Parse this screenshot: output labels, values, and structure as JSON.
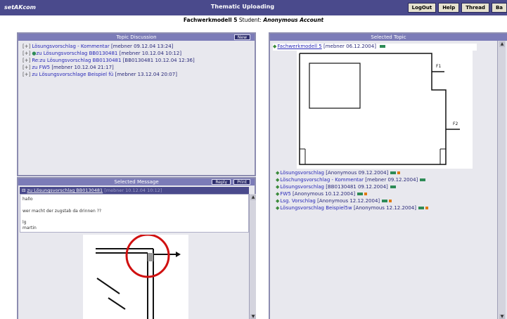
{
  "app": {
    "logo": "setAKcom",
    "title": "Thematic Uploading",
    "buttons": [
      "LogOut",
      "Help",
      "Thread",
      "Ba"
    ]
  },
  "subtitle": {
    "topic": "Fachwerkmodell 5",
    "student_label": "Student:",
    "student": "Anonymous Account"
  },
  "topic_discussion": {
    "title": "Topic Discussion",
    "new_label": "New",
    "rows": [
      {
        "tree": "[+]",
        "title": "Lösungsvorschlag - Kommentar",
        "meta": "[mebner 09.12.04 13:24]"
      },
      {
        "tree": "[+]",
        "title": "zu Lösungsvorschlag BB0130481",
        "meta": "[mebner 10.12.04 10:12]"
      },
      {
        "tree": "[+]",
        "title": "Re:zu Lösungsvorschlag BB0130481",
        "meta": "[BB0130481 10.12.04 12:36]"
      },
      {
        "tree": "[+]",
        "title": "zu FW5",
        "meta": "[mebner 10.12.04 21:17]"
      },
      {
        "tree": "[+]",
        "title": "zu Lösungsvorschlage Beispiel fü",
        "meta": "[mebner 13.12.04 20:07]"
      }
    ]
  },
  "selected_message": {
    "title": "Selected Message",
    "reply_label": "Reply",
    "print_label": "Print",
    "subject": "zu Lösungsvorschlag BB0130481",
    "subject_meta": "[mebner 10.12.04 10:12]",
    "body_lines": [
      "hallo",
      "wer macht der zugstab da drinnen ??",
      "lg",
      "martin"
    ]
  },
  "selected_topic": {
    "title": "Selected Topic",
    "head_link": "Fachwerkmodell 5",
    "head_meta": "[mebner 06.12.2004]",
    "drawing_labels": [
      "F1",
      "F2"
    ],
    "items": [
      {
        "title": "Lösungsvorschlag",
        "meta": "[Anonymous 09.12.2004]"
      },
      {
        "title": "Löschungsvorschlag - Kommentar",
        "meta": "[mebner 09.12.2004]"
      },
      {
        "title": "Lösungsvorschlag",
        "meta": "[BB0130481 09.12.2004]"
      },
      {
        "title": "FW5",
        "meta": "[Anonymous 10.12.2004]"
      },
      {
        "title": "Lsg. Vorschlag",
        "meta": "[Anonymous 12.12.2004]"
      },
      {
        "title": "Lösungsvorschlag Beispiel5w",
        "meta": "[Anonymous 12.12.2004]"
      }
    ]
  },
  "colors": {
    "header": "#4a4a8c",
    "panel_header": "#7c7cb8",
    "panel_bg": "#e8e8ee",
    "link": "#2a2ab8",
    "attachment_green": "#2e8b57",
    "attachment_orange": "#e07a10",
    "annotation_red": "#d01010"
  }
}
